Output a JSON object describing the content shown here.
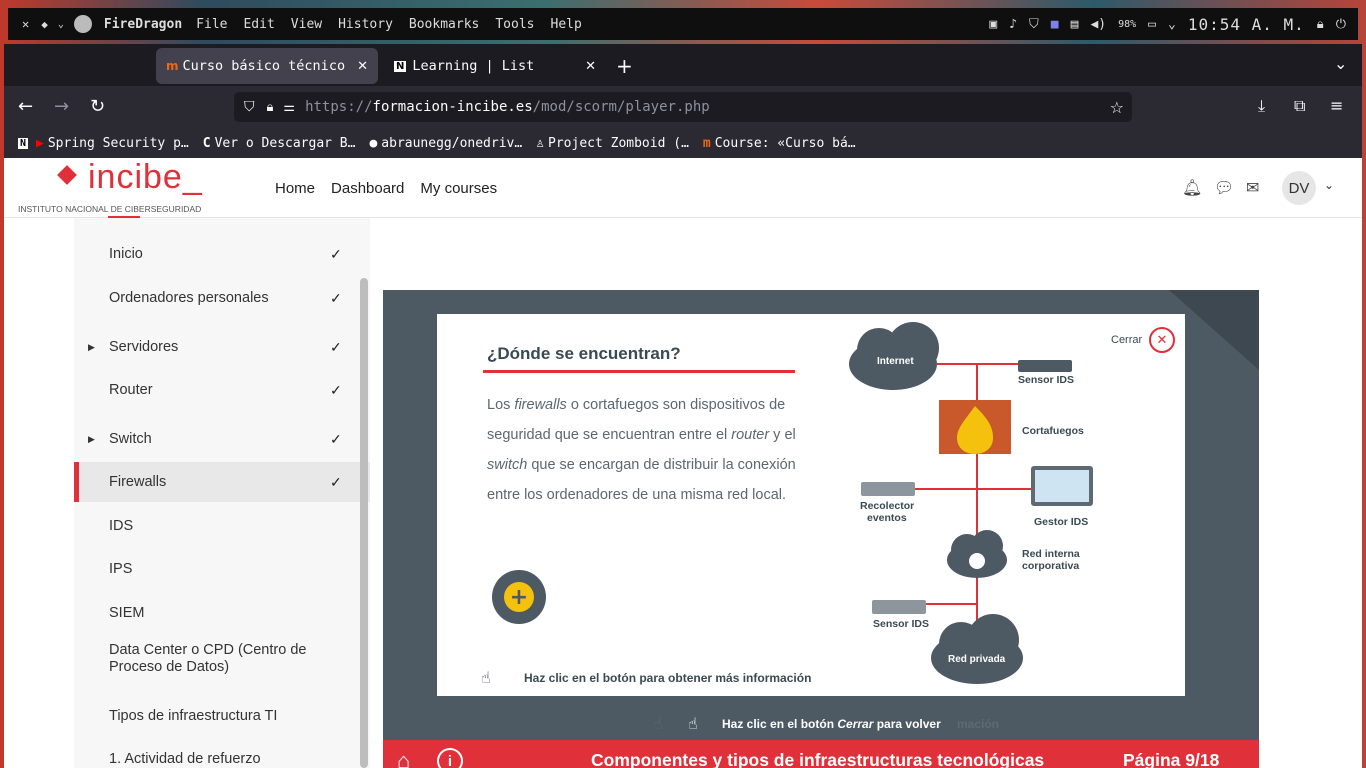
{
  "system": {
    "menu": [
      "File",
      "Edit",
      "View",
      "History",
      "Bookmarks",
      "Tools",
      "Help"
    ],
    "app_name": "FireDragon",
    "battery": "98%",
    "clock": "10:54 A. M."
  },
  "browser": {
    "tabs": [
      {
        "label": "Curso básico técnico"
      },
      {
        "label": "Learning | List"
      }
    ],
    "url_scheme": "https://",
    "url_domain": "formacion-incibe.es",
    "url_path": "/mod/scorm/player.php",
    "bookmarks": [
      {
        "label": "Spring Security p…"
      },
      {
        "label": "Ver o Descargar B…"
      },
      {
        "label": "abraunegg/onedriv…"
      },
      {
        "label": "Project Zomboid (…"
      },
      {
        "label": "Course: «Curso bá…"
      }
    ]
  },
  "site": {
    "logo_text": "incibe_",
    "logo_subtitle": "INSTITUTO NACIONAL DE CIBERSEGURIDAD",
    "nav": [
      "Home",
      "Dashboard",
      "My courses"
    ],
    "user_initials": "DV"
  },
  "sidebar": {
    "items": [
      {
        "label": "Inicio",
        "checked": true
      },
      {
        "label": "Ordenadores personales",
        "checked": true
      },
      {
        "label": "Servidores",
        "checked": true
      },
      {
        "label": "Router",
        "checked": true
      },
      {
        "label": "Switch",
        "checked": true
      },
      {
        "label": "Firewalls",
        "checked": true
      },
      {
        "label": "IDS",
        "checked": false
      },
      {
        "label": "IPS",
        "checked": false
      },
      {
        "label": "SIEM",
        "checked": false
      },
      {
        "label": "Data Center o CPD (Centro de",
        "label2": "Proceso de Datos)",
        "checked": false
      },
      {
        "label": "Tipos de infraestructura TI",
        "checked": false
      },
      {
        "label": "1. Actividad de refuerzo",
        "checked": false
      }
    ]
  },
  "scorm": {
    "title": "¿Dónde se encuentran?",
    "close_label": "Cerrar",
    "paragraph": {
      "p1": "Los ",
      "p2": "firewalls",
      "p3": " o cortafuegos son dispositivos de seguridad que se encuentran entre el ",
      "p4": "router",
      "p5": " y el ",
      "p6": "switch",
      "p7": " que se encargan de distribuir la conexión entre los ordenadores de una misma red local."
    },
    "hint_more": "Haz clic en el botón para obtener más información",
    "hint_close_a": "Haz clic en el botón ",
    "hint_close_b": "Cerrar",
    "hint_close_c": " para volver",
    "behind_text": "mación",
    "footer_title": "Componentes y tipos de infraestructuras tecnológicas",
    "page_indicator": "Página 9/18",
    "diagram": {
      "internet": "Internet",
      "sensor_ids_1": "Sensor IDS",
      "cortafuegos": "Cortafuegos",
      "recolector": "Recolector",
      "eventos": "eventos",
      "gestor_ids": "Gestor IDS",
      "red_interna_1": "Red interna",
      "red_interna_2": "corporativa",
      "sensor_ids_2": "Sensor IDS",
      "red_privada": "Red privada"
    }
  },
  "colors": {
    "accent": "#e0303a",
    "slide_bg": "#4e5a63",
    "text_dark": "#3a4a54"
  }
}
